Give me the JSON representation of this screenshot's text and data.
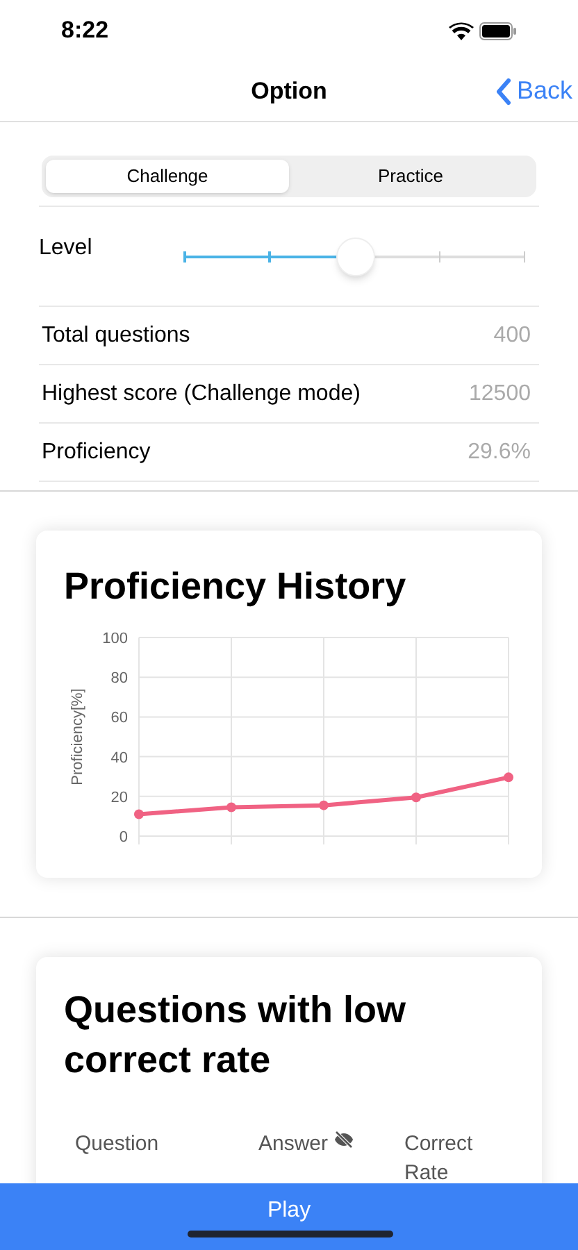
{
  "status_bar": {
    "time": "8:22"
  },
  "nav": {
    "title": "Option",
    "back": "Back"
  },
  "tabs": [
    {
      "label": "Challenge",
      "selected": true
    },
    {
      "label": "Practice",
      "selected": false
    }
  ],
  "level_row": {
    "label": "Level",
    "level": 0.5
  },
  "stats": [
    {
      "label": "Total questions",
      "value": "400"
    },
    {
      "label": "Highest score (Challenge mode)",
      "value": "12500"
    },
    {
      "label": "Proficiency",
      "value": "29.6%"
    }
  ],
  "history_card": {
    "title": "Proficiency History",
    "chart_data": {
      "type": "line",
      "ylabel": "Proficiency[%]",
      "ylim": [
        0,
        100
      ],
      "yticks": [
        0,
        20,
        40,
        60,
        80,
        100
      ],
      "grid": true,
      "series": [
        {
          "color": "#f06283",
          "marker": true,
          "values": [
            11,
            14.5,
            15.5,
            19.5,
            29.6
          ]
        }
      ]
    }
  },
  "low_rate_card": {
    "title": "Questions with low correct rate",
    "columns": [
      "Question",
      "Answer",
      "Correct Rate"
    ]
  },
  "play_button": "Play"
}
